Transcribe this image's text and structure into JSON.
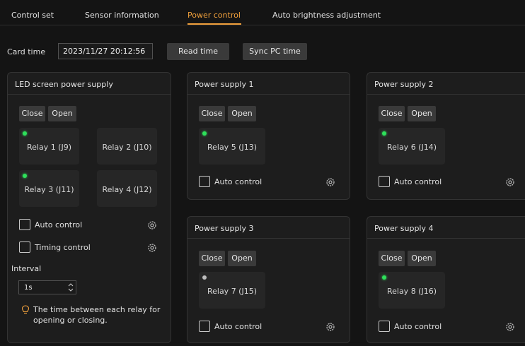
{
  "tabs": [
    {
      "label": "Control set",
      "active": false
    },
    {
      "label": "Sensor information",
      "active": false
    },
    {
      "label": "Power control",
      "active": true
    },
    {
      "label": "Auto brightness adjustment",
      "active": false
    }
  ],
  "card_time": {
    "label": "Card time",
    "value": "2023/11/27 20:12:56",
    "read_button": "Read time",
    "sync_button": "Sync PC time"
  },
  "led_panel": {
    "title": "LED screen power supply",
    "close_label": "Close",
    "open_label": "Open",
    "relays": [
      {
        "label": "Relay 1 (J9)",
        "status": "on"
      },
      {
        "label": "Relay 2 (J10)",
        "status": "none"
      },
      {
        "label": "Relay 3 (J11)",
        "status": "on"
      },
      {
        "label": "Relay 4 (J12)",
        "status": "none"
      }
    ],
    "auto_control_label": "Auto control",
    "timing_control_label": "Timing control",
    "interval_label": "Interval",
    "interval_value": "1s",
    "hint": "The time between each relay for opening or closing."
  },
  "power_supplies": [
    {
      "title": "Power supply 1",
      "close_label": "Close",
      "open_label": "Open",
      "relay_label": "Relay 5 (J13)",
      "status": "on",
      "auto_control_label": "Auto control"
    },
    {
      "title": "Power supply 2",
      "close_label": "Close",
      "open_label": "Open",
      "relay_label": "Relay 6 (J14)",
      "status": "on",
      "auto_control_label": "Auto control"
    },
    {
      "title": "Power supply 3",
      "close_label": "Close",
      "open_label": "Open",
      "relay_label": "Relay 7 (J15)",
      "status": "off",
      "auto_control_label": "Auto control"
    },
    {
      "title": "Power supply 4",
      "close_label": "Close",
      "open_label": "Open",
      "relay_label": "Relay 8 (J16)",
      "status": "on",
      "auto_control_label": "Auto control"
    }
  ],
  "colors": {
    "accent": "#f0a03c",
    "relay_on": "#2ee05a",
    "relay_off": "#bcbcbc",
    "background": "#141414",
    "panel": "#1d1d1d"
  },
  "icons": {
    "settings": "gear-icon",
    "hint": "lightbulb-icon",
    "spinner": "stepper-arrows-icon"
  }
}
